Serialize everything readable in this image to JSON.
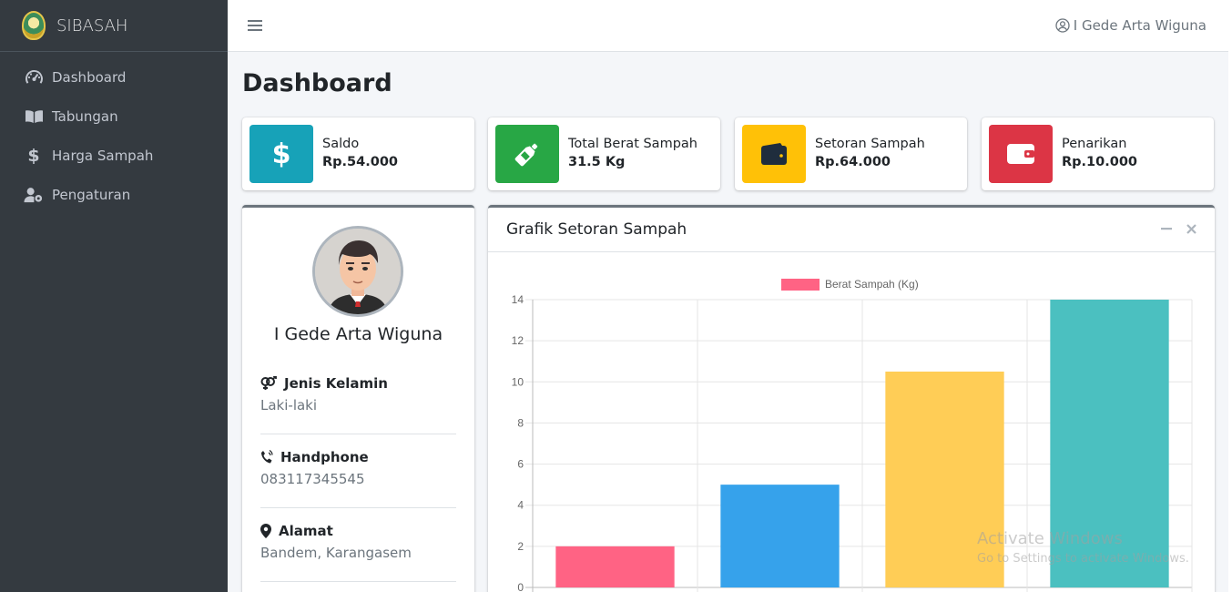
{
  "brand": {
    "name": "SIBASAH"
  },
  "sidebar": {
    "items": [
      {
        "label": "Dashboard",
        "icon": "tachometer-icon"
      },
      {
        "label": "Tabungan",
        "icon": "book-icon"
      },
      {
        "label": "Harga Sampah",
        "icon": "dollar-icon"
      },
      {
        "label": "Pengaturan",
        "icon": "user-cog-icon"
      }
    ]
  },
  "topbar": {
    "user": "I Gede Arta Wiguna"
  },
  "page": {
    "title": "Dashboard"
  },
  "stats": [
    {
      "label": "Saldo",
      "value": "Rp.54.000",
      "color": "#17a2b8",
      "icon": "dollar-icon"
    },
    {
      "label": "Total Berat Sampah",
      "value": "31.5 Kg",
      "color": "#28a745",
      "icon": "bottle-icon"
    },
    {
      "label": "Setoran Sampah",
      "value": "Rp.64.000",
      "color": "#ffc107",
      "icon": "wallet-icon"
    },
    {
      "label": "Penarikan",
      "value": "Rp.10.000",
      "color": "#dc3545",
      "icon": "wallet-open-icon"
    }
  ],
  "profile": {
    "name": "I Gede Arta Wiguna",
    "gender_label": "Jenis Kelamin",
    "gender": "Laki-laki",
    "phone_label": "Handphone",
    "phone": "083117345545",
    "address_label": "Alamat",
    "address": "Bandem, Karangasem"
  },
  "chart_card": {
    "title": "Grafik Setoran Sampah"
  },
  "chart_data": {
    "type": "bar",
    "title": "",
    "legend": "Berat Sampah (Kg)",
    "legend_placement": "top-center",
    "categories": [
      "",
      "",
      "",
      ""
    ],
    "values": [
      2,
      5,
      10.5,
      14
    ],
    "colors": [
      "#ff6384",
      "#36a2eb",
      "#ffcd56",
      "#4bc0c0"
    ],
    "ylim": [
      0,
      14
    ],
    "yticks": [
      "0",
      "2",
      "4",
      "6",
      "8",
      "10",
      "12",
      "14"
    ],
    "grid": true
  },
  "watermark": {
    "line1": "Activate Windows",
    "line2": "Go to Settings to activate Windows."
  }
}
